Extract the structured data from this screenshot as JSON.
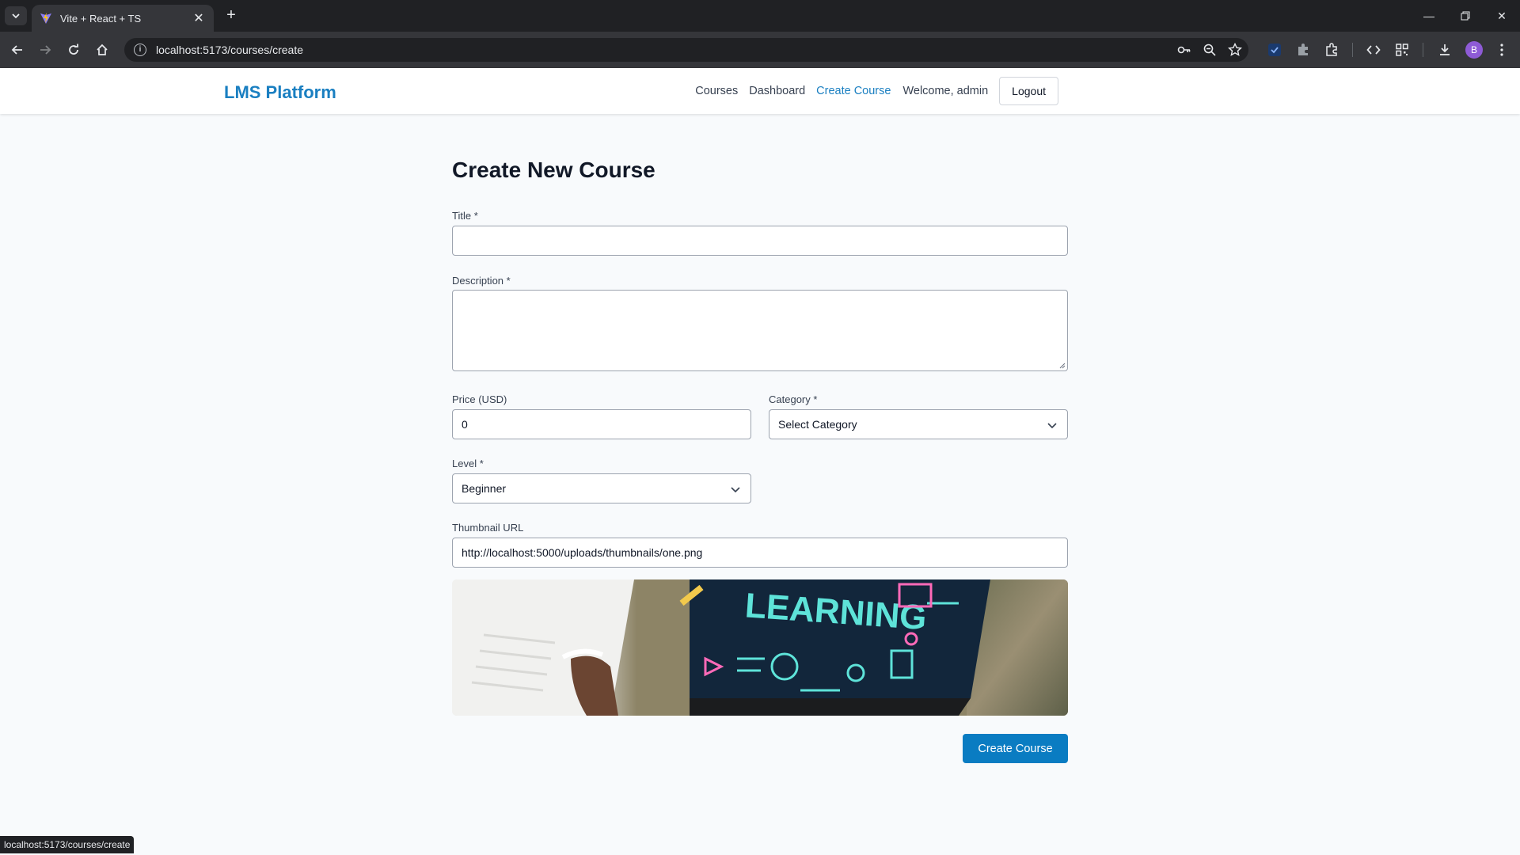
{
  "browser": {
    "tab_title": "Vite + React + TS",
    "url": "localhost:5173/courses/create",
    "profile_initial": "B",
    "status_url": "localhost:5173/courses/create"
  },
  "header": {
    "brand": "LMS Platform",
    "nav": [
      "Courses",
      "Dashboard",
      "Create Course"
    ],
    "active_nav": "Create Course",
    "welcome": "Welcome, admin",
    "logout_label": "Logout",
    "accent_color": "#1a7fc1"
  },
  "form": {
    "heading": "Create New Course",
    "title": {
      "label": "Title *",
      "value": ""
    },
    "description": {
      "label": "Description *",
      "value": ""
    },
    "price": {
      "label": "Price (USD)",
      "value": "0"
    },
    "category": {
      "label": "Category *",
      "value": "Select Category"
    },
    "level": {
      "label": "Level *",
      "value": "Beginner"
    },
    "thumbnail": {
      "label": "Thumbnail URL",
      "value": "http://localhost:5000/uploads/thumbnails/one.png",
      "image_text": "LEARNING"
    },
    "submit_label": "Create Course",
    "submit_color": "#0a7cc2"
  }
}
